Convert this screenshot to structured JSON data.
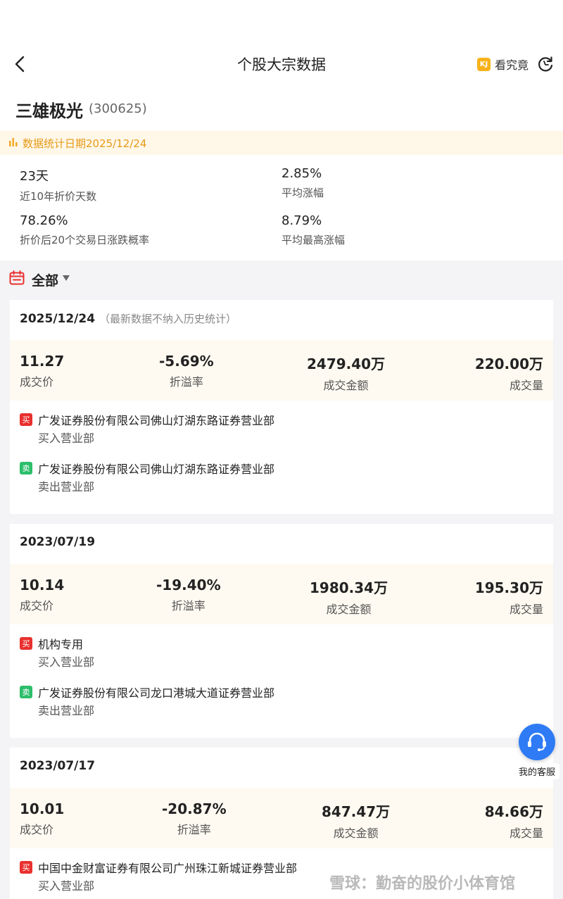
{
  "header": {
    "title": "个股大宗数据",
    "kanjiujing_logo": "KJ",
    "kanjiujing_label": "看究竟"
  },
  "stock": {
    "name": "三雄极光",
    "code": "(300625)"
  },
  "stat_date": "数据统计日期2025/12/24",
  "stats": [
    {
      "value": "23天",
      "label": "近10年折价天数"
    },
    {
      "value": "2.85%",
      "label": "平均涨幅"
    },
    {
      "value": "78.26%",
      "label": "折价后20个交易日涨跌概率"
    },
    {
      "value": "8.79%",
      "label": "平均最高涨幅"
    }
  ],
  "filter": {
    "label": "全部"
  },
  "metric_labels": {
    "price": "成交价",
    "premium": "折溢率",
    "amount": "成交金额",
    "volume": "成交量"
  },
  "tags": {
    "buy": "买",
    "sell": "卖"
  },
  "role_labels": {
    "buy": "买入营业部",
    "sell": "卖出营业部"
  },
  "trades": [
    {
      "date": "2025/12/24",
      "note": "（最新数据不纳入历史统计）",
      "price": "11.27",
      "premium": "-5.69%",
      "amount": "2479.40万",
      "volume": "220.00万",
      "buyer": "广发证券股份有限公司佛山灯湖东路证券营业部",
      "seller": "广发证券股份有限公司佛山灯湖东路证券营业部"
    },
    {
      "date": "2023/07/19",
      "note": "",
      "price": "10.14",
      "premium": "-19.40%",
      "amount": "1980.34万",
      "volume": "195.30万",
      "buyer": "机构专用",
      "seller": "广发证券股份有限公司龙口港城大道证券营业部"
    },
    {
      "date": "2023/07/17",
      "note": "",
      "price": "10.01",
      "premium": "-20.87%",
      "amount": "847.47万",
      "volume": "84.66万",
      "buyer": "中国中金财富证券有限公司广州珠江新城证券营业部"
    }
  ],
  "service": {
    "label": "我的客服"
  },
  "watermark": "雪球：勤奋的股价小体育馆"
}
